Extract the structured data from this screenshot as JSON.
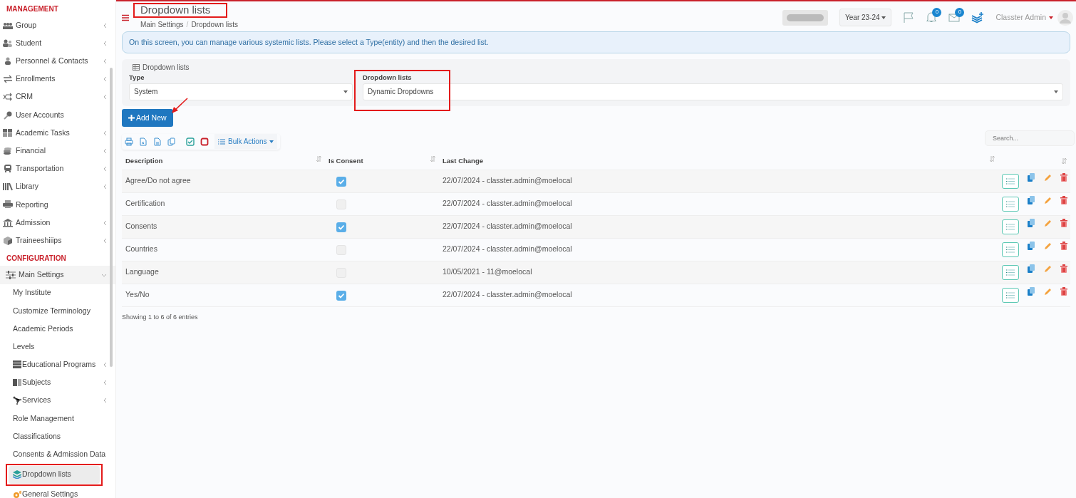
{
  "sidebar": {
    "sections": [
      {
        "title": "MANAGEMENT",
        "items": [
          {
            "label": "Group",
            "expandable": true,
            "selected": false
          },
          {
            "label": "Student",
            "expandable": true,
            "selected": false
          },
          {
            "label": "Personnel & Contacts",
            "expandable": true,
            "selected": false
          },
          {
            "label": "Enrollments",
            "expandable": true,
            "selected": false
          },
          {
            "label": "CRM",
            "expandable": true,
            "selected": false
          },
          {
            "label": "User Accounts",
            "expandable": false,
            "selected": false
          },
          {
            "label": "Academic Tasks",
            "expandable": true,
            "selected": false
          },
          {
            "label": "Financial",
            "expandable": true,
            "selected": false
          },
          {
            "label": "Transportation",
            "expandable": true,
            "selected": false
          },
          {
            "label": "Library",
            "expandable": true,
            "selected": false
          },
          {
            "label": "Reporting",
            "expandable": false,
            "selected": false
          },
          {
            "label": "Admission",
            "expandable": true,
            "selected": false
          },
          {
            "label": "Traineeshiiips",
            "expandable": true,
            "selected": false
          }
        ]
      },
      {
        "title": "CONFIGURATION",
        "items": [
          {
            "label": "Main Settings",
            "expandable": true,
            "expanded": true,
            "selected": false,
            "children": [
              {
                "label": "My Institute",
                "expandable": false,
                "selected": false
              },
              {
                "label": "Customize Terminology",
                "expandable": false,
                "selected": false
              },
              {
                "label": "Academic Periods",
                "expandable": false,
                "selected": false
              },
              {
                "label": "Levels",
                "expandable": false,
                "selected": false
              },
              {
                "label": "Educational Programs",
                "expandable": true,
                "selected": false
              },
              {
                "label": "Subjects",
                "expandable": true,
                "selected": false
              },
              {
                "label": "Services",
                "expandable": true,
                "selected": false
              },
              {
                "label": "Role Management",
                "expandable": false,
                "selected": false
              },
              {
                "label": "Classifications",
                "expandable": false,
                "selected": false
              },
              {
                "label": "Consents & Admission Data",
                "expandable": false,
                "selected": false
              },
              {
                "label": "Dropdown lists",
                "expandable": false,
                "selected": true
              },
              {
                "label": "General Settings",
                "expandable": false,
                "selected": false
              }
            ]
          }
        ]
      }
    ]
  },
  "header": {
    "title": "Dropdown lists",
    "breadcrumb": [
      "Main Settings",
      "Dropdown lists"
    ],
    "breadcrumb_separator": "/",
    "year": "Year 23-24",
    "notifications_badge": "0",
    "messages_badge": "0",
    "user": "Classter Admin"
  },
  "info": "On this screen, you can manage various systemic lists. Please select a Type(entity) and then the desired list.",
  "filter_panel": {
    "legend": "Dropdown lists",
    "fields": [
      {
        "label": "Type",
        "value": "System"
      },
      {
        "label": "Dropdown lists",
        "value": "Dynamic Dropdowns"
      }
    ]
  },
  "add_button": "Add New",
  "bulk_actions": "Bulk Actions",
  "search": {
    "placeholder": "Search..."
  },
  "table": {
    "columns": [
      "Description",
      "Is Consent",
      "Last Change"
    ],
    "rows": [
      {
        "description": "Agree/Do not agree",
        "is_consent": true,
        "last_change": "22/07/2024 - classter.admin@moelocal"
      },
      {
        "description": "Certification",
        "is_consent": false,
        "last_change": "22/07/2024 - classter.admin@moelocal"
      },
      {
        "description": "Consents",
        "is_consent": true,
        "last_change": "22/07/2024 - classter.admin@moelocal"
      },
      {
        "description": "Countries",
        "is_consent": false,
        "last_change": "22/07/2024 - classter.admin@moelocal"
      },
      {
        "description": "Language",
        "is_consent": false,
        "last_change": "10/05/2021 - 11@moelocal"
      },
      {
        "description": "Yes/No",
        "is_consent": true,
        "last_change": "22/07/2024 - classter.admin@moelocal"
      }
    ]
  },
  "table_info": "Showing 1 to 6 of 6 entries"
}
